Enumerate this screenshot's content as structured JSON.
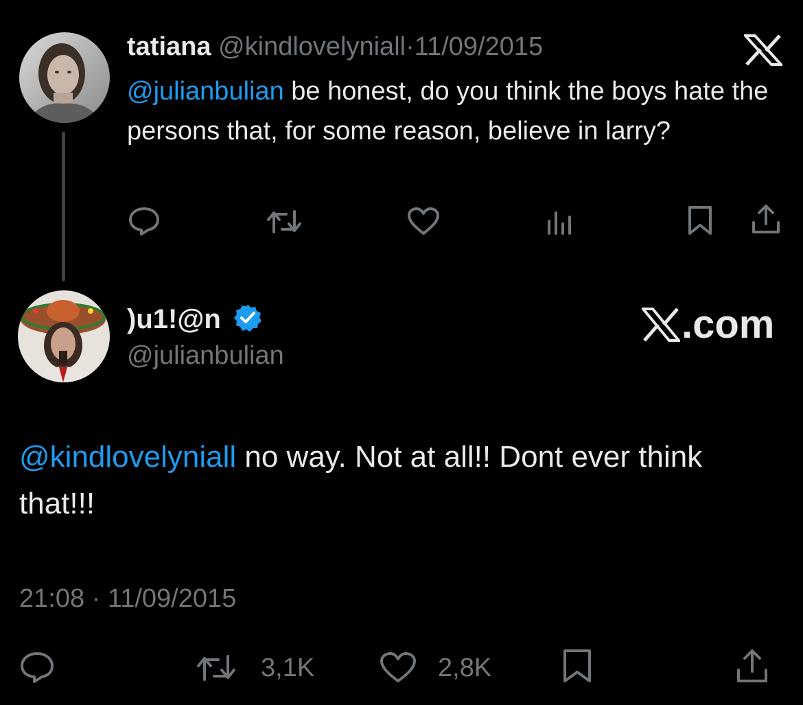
{
  "parent_tweet": {
    "name": "tatiana",
    "handle": "@kindlovelyniall",
    "separator": "·",
    "date": "11/09/2015",
    "mention": "@julianbulian",
    "text": " be honest, do you think the boys hate the persons that, for some reason, believe in larry?",
    "actions": [
      "reply-icon",
      "retweet-icon",
      "like-icon",
      "views-icon",
      "bookmark-icon",
      "share-icon"
    ]
  },
  "main_tweet": {
    "name": ")u1!@n",
    "handle": "@julianbulian",
    "badge": "verified-badge-icon",
    "watermark": ".com",
    "mention": "@kindlovelyniall",
    "text": " no way. Not at all!!  Dont ever think that!!!",
    "time": "21:08",
    "separator": "·",
    "date": "11/09/2015",
    "retweets": "3,1K",
    "likes": "2,8K",
    "actions": [
      "reply-icon",
      "retweet-icon",
      "like-icon",
      "bookmark-icon",
      "share-icon"
    ]
  },
  "colors": {
    "background": "#000000",
    "text": "#e7e9ea",
    "muted": "#71767b",
    "link": "#1d9bf0",
    "verified": "#1d9bf0",
    "thread_line": "#3e4144"
  }
}
